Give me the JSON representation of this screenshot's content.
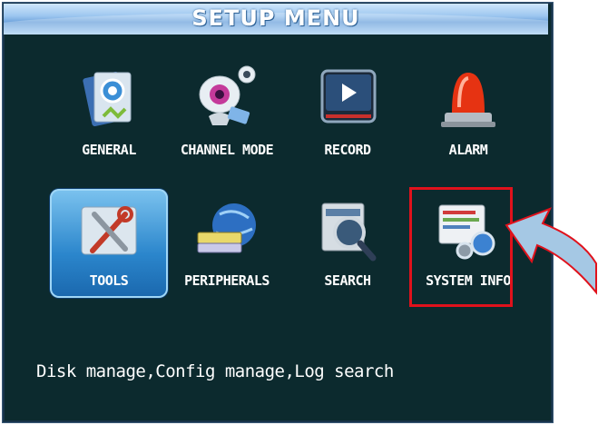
{
  "window": {
    "title": "SETUP  MENU"
  },
  "menu": {
    "items": [
      {
        "label": "GENERAL",
        "icon": "general-settings-icon"
      },
      {
        "label": "CHANNEL MODE",
        "icon": "webcam-icon"
      },
      {
        "label": "RECORD",
        "icon": "record-play-icon"
      },
      {
        "label": "ALARM",
        "icon": "alarm-siren-icon"
      },
      {
        "label": "TOOLS",
        "icon": "tools-icon",
        "selected": true
      },
      {
        "label": "PERIPHERALS",
        "icon": "peripherals-icon"
      },
      {
        "label": "SEARCH",
        "icon": "search-magnifier-icon"
      },
      {
        "label": "SYSTEM INFO",
        "icon": "system-info-icon",
        "annotated": true
      }
    ]
  },
  "status": {
    "text": "Disk manage,Config manage,Log search"
  },
  "colors": {
    "background": "#0c2a2e",
    "title_bar": "#8cbef0",
    "selected_tile": "#2b86cc",
    "annotation_red": "#e0121c",
    "annotation_arrow": "#a5c8e4"
  }
}
